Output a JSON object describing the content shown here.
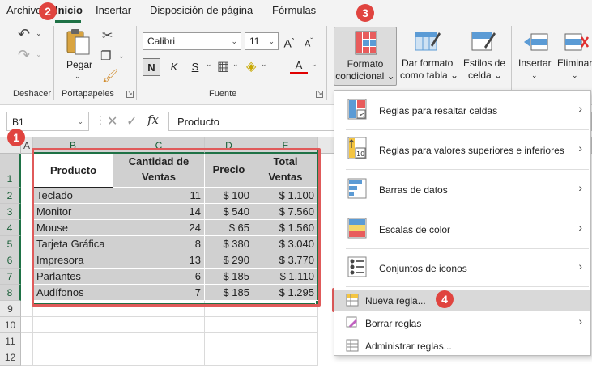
{
  "tabs": [
    "Archivo",
    "Inicio",
    "Insertar",
    "Disposición de página",
    "Fórmulas"
  ],
  "ribbon": {
    "groups": {
      "undo": "Deshacer",
      "clipboard": "Portapapeles",
      "font": "Fuente"
    },
    "paste": "Pegar",
    "font_name": "Calibri",
    "font_size": "11",
    "bold": "N",
    "italic": "K",
    "underline": "S",
    "grow_font": "A",
    "shrink_font": "A",
    "font_color": "A",
    "cond_format": [
      "Formato",
      "condicional"
    ],
    "format_table": [
      "Dar formato",
      "como tabla"
    ],
    "cell_styles": [
      "Estilos de",
      "celda"
    ],
    "insert": "Insertar",
    "delete": "Eliminar"
  },
  "formula_bar": {
    "name_box": "B1",
    "fx": "fx",
    "value": "Producto"
  },
  "sheet": {
    "columns": [
      "A",
      "B",
      "C",
      "D",
      "E"
    ],
    "rows": [
      "1",
      "2",
      "3",
      "4",
      "5",
      "6",
      "7",
      "8",
      "9",
      "10",
      "11",
      "12"
    ],
    "headers": {
      "producto": "Producto",
      "cantidad": [
        "Cantidad de",
        "Ventas"
      ],
      "precio": "Precio",
      "total": [
        "Total",
        "Ventas"
      ]
    },
    "data": [
      [
        "Teclado",
        "11",
        "$ 100",
        "$ 1.100"
      ],
      [
        "Monitor",
        "14",
        "$ 540",
        "$ 7.560"
      ],
      [
        "Mouse",
        "24",
        "$ 65",
        "$ 1.560"
      ],
      [
        "Tarjeta Gráfica",
        "8",
        "$ 380",
        "$ 3.040"
      ],
      [
        "Impresora",
        "13",
        "$ 290",
        "$ 3.770"
      ],
      [
        "Parlantes",
        "6",
        "$ 185",
        "$ 1.110"
      ],
      [
        "Audífonos",
        "7",
        "$ 185",
        "$ 1.295"
      ]
    ]
  },
  "menu": {
    "items": [
      "Reglas para resaltar celdas",
      "Reglas para valores superiores e inferiores",
      "Barras de datos",
      "Escalas de color",
      "Conjuntos de iconos",
      "Nueva regla...",
      "Borrar reglas",
      "Administrar reglas..."
    ],
    "icon_label_10": "10"
  },
  "badges": [
    "1",
    "2",
    "3",
    "4"
  ],
  "colors": {
    "accent_green": "#1e7145",
    "annotation_red": "#e05a5a",
    "badge_red": "#e0443f"
  }
}
